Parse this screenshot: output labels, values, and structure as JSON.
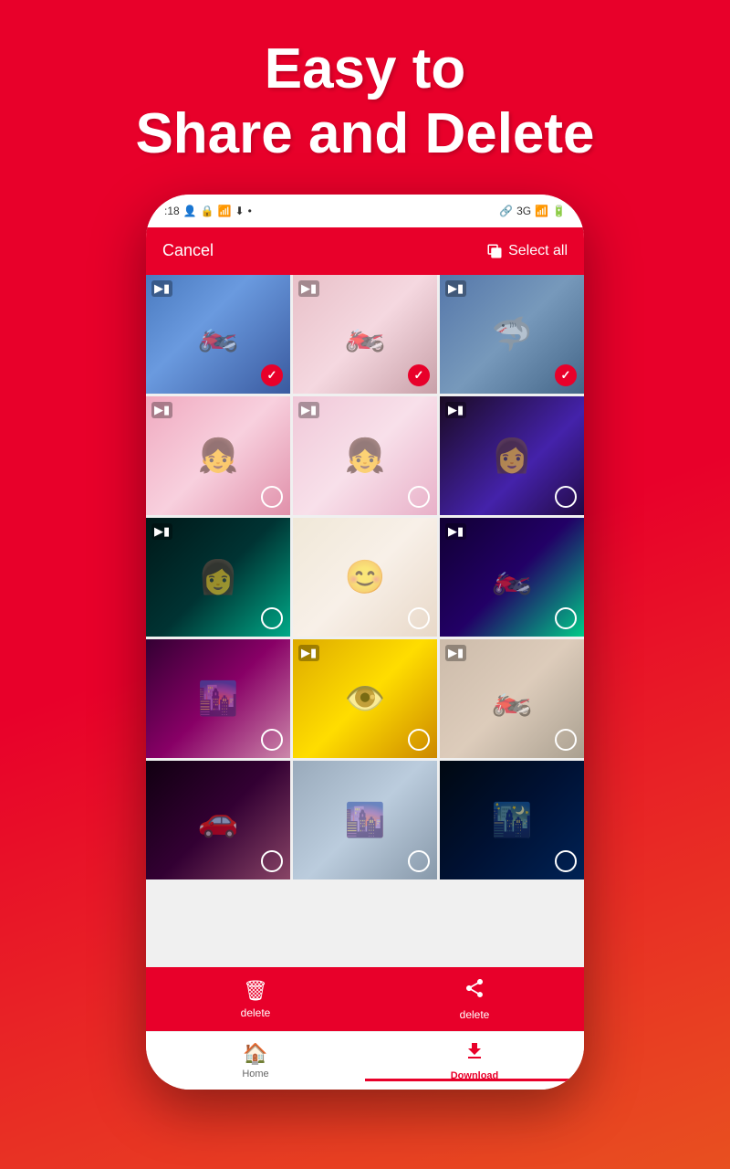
{
  "hero": {
    "line1": "Easy to",
    "line2": "Share and Delete"
  },
  "header": {
    "cancel_label": "Cancel",
    "select_all_label": "Select all"
  },
  "action_bar": {
    "delete_label": "delete",
    "share_label": "delete"
  },
  "bottom_nav": {
    "home_label": "Home",
    "download_label": "Download"
  },
  "grid_items": [
    {
      "id": 1,
      "type": "video",
      "selected": true,
      "color_class": "item-blue-moto"
    },
    {
      "id": 2,
      "type": "video",
      "selected": true,
      "color_class": "item-pink-moto"
    },
    {
      "id": 3,
      "type": "video",
      "selected": true,
      "color_class": "item-blue-shark"
    },
    {
      "id": 4,
      "type": "video",
      "selected": false,
      "color_class": "item-pink-girl"
    },
    {
      "id": 5,
      "type": "video",
      "selected": false,
      "color_class": "item-pink-idol"
    },
    {
      "id": 6,
      "type": "video",
      "selected": false,
      "color_class": "item-dark-girl"
    },
    {
      "id": 7,
      "type": "video",
      "selected": false,
      "color_class": "item-teal-girl"
    },
    {
      "id": 8,
      "type": "image",
      "selected": false,
      "color_class": "item-smiling-girl"
    },
    {
      "id": 9,
      "type": "video",
      "selected": false,
      "color_class": "item-neon-moto"
    },
    {
      "id": 10,
      "type": "image",
      "selected": false,
      "color_class": "item-anime-city"
    },
    {
      "id": 11,
      "type": "video",
      "selected": false,
      "color_class": "item-minion"
    },
    {
      "id": 12,
      "type": "video",
      "selected": false,
      "color_class": "item-moto-desert"
    },
    {
      "id": 13,
      "type": "image",
      "selected": false,
      "color_class": "item-purple-car"
    },
    {
      "id": 14,
      "type": "image",
      "selected": false,
      "color_class": "item-city-fog"
    },
    {
      "id": 15,
      "type": "image",
      "selected": false,
      "color_class": "item-night-city"
    }
  ]
}
